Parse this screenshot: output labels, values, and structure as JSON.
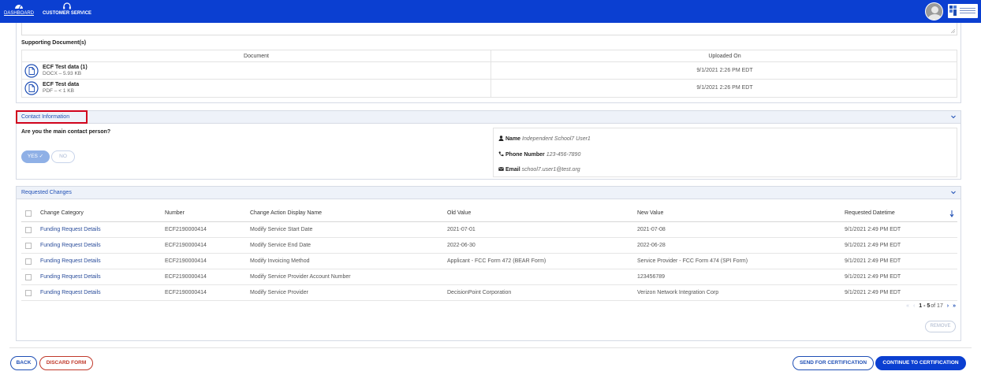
{
  "header": {
    "nav": [
      {
        "label": "DASHBOARD",
        "icon": "dashboard-gauge-icon"
      },
      {
        "label": "CUSTOMER SERVICE",
        "icon": "headset-icon"
      }
    ],
    "avatar_icon": "user-avatar-icon",
    "logo_icon": "usac-logo-icon",
    "bar_color": "#0b3fd1"
  },
  "supporting_documents": {
    "label": "Supporting Document(s)",
    "columns": [
      "Document",
      "Uploaded On"
    ],
    "rows": [
      {
        "name": "ECF Test data (1)",
        "meta": "DOCX – 5.93 KB",
        "uploaded": "9/1/2021 2:26 PM EDT"
      },
      {
        "name": "ECF Test data",
        "meta": "PDF – < 1 KB",
        "uploaded": "9/1/2021 2:26 PM EDT"
      }
    ]
  },
  "contact": {
    "title": "Contact Information",
    "question": "Are you the main contact person?",
    "yes_label": "YES ✓",
    "no_label": "NO",
    "name_label": "Name",
    "name_value": "Independent School7 User1",
    "phone_label": "Phone Number",
    "phone_value": "123-456-7890",
    "email_label": "Email",
    "email_value": "school7.user1@test.org"
  },
  "requested_changes": {
    "title": "Requested Changes",
    "columns": [
      "Change Category",
      "Number",
      "Change Action Display Name",
      "Old Value",
      "New Value",
      "Requested Datetime"
    ],
    "rows": [
      [
        "Funding Request Details",
        "ECF2190000414",
        "Modify Service Start Date",
        "2021-07-01",
        "2021-07-08",
        "9/1/2021 2:49 PM EDT"
      ],
      [
        "Funding Request Details",
        "ECF2190000414",
        "Modify Service End Date",
        "2022-06-30",
        "2022-06-28",
        "9/1/2021 2:49 PM EDT"
      ],
      [
        "Funding Request Details",
        "ECF2190000414",
        "Modify Invoicing Method",
        "Applicant - FCC Form 472 (BEAR Form)",
        "Service Provider - FCC Form 474 (SPI Form)",
        "9/1/2021 2:49 PM EDT"
      ],
      [
        "Funding Request Details",
        "ECF2190000414",
        "Modify Service Provider Account Number",
        "",
        "123456789",
        "9/1/2021 2:49 PM EDT"
      ],
      [
        "Funding Request Details",
        "ECF2190000414",
        "Modify Service Provider",
        "DecisionPoint Corporation",
        "Verizon Network Integration Corp",
        "9/1/2021 2:49 PM EDT"
      ]
    ],
    "pager": {
      "range": "1 - 5",
      "of": "of 17"
    },
    "remove_label": "REMOVE"
  },
  "footer": {
    "back": "BACK",
    "discard": "DISCARD FORM",
    "send": "SEND FOR CERTIFICATION",
    "continue": "CONTINUE TO CERTIFICATION"
  }
}
